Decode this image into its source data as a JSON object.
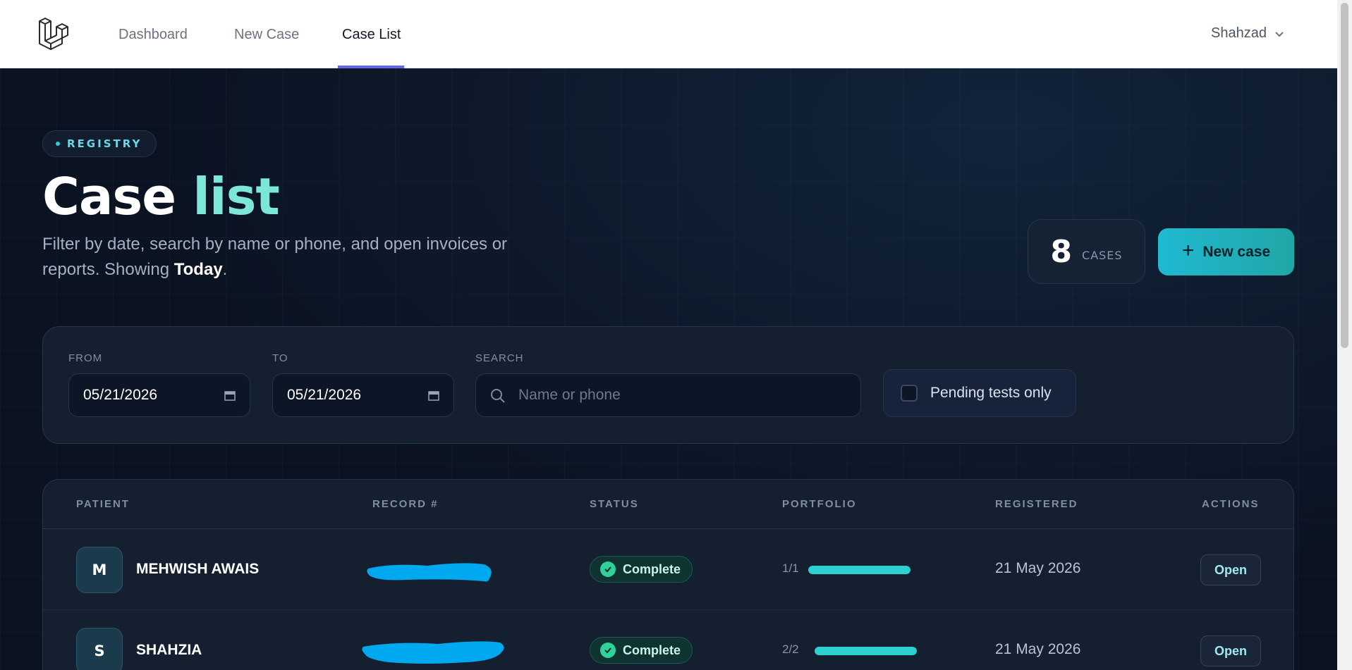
{
  "nav": {
    "links": [
      {
        "label": "Dashboard",
        "active": false
      },
      {
        "label": "New Case",
        "active": false
      },
      {
        "label": "Case List",
        "active": true
      }
    ],
    "user": "Shahzad"
  },
  "header": {
    "badge": "REGISTRY",
    "title_main": "Case",
    "title_accent": "list",
    "subtitle_prefix": "Filter by date, search by name or phone, and open invoices or reports. Showing ",
    "subtitle_strong": "Today",
    "subtitle_suffix": ".",
    "case_count": "8",
    "case_count_label": "CASES",
    "new_case_label": "New case"
  },
  "filters": {
    "from_label": "FROM",
    "from_value": "05/21/2026",
    "to_label": "TO",
    "to_value": "05/21/2026",
    "search_label": "SEARCH",
    "search_placeholder": "Name or phone",
    "pending_label": "Pending tests only",
    "pending_checked": false
  },
  "table": {
    "columns": [
      "PATIENT",
      "RECORD #",
      "STATUS",
      "PORTFOLIO",
      "REGISTERED",
      "ACTIONS"
    ],
    "rows": [
      {
        "initial": "M",
        "name": "MEHWISH AWAIS",
        "status": "Complete",
        "portfolio": "1/1",
        "progress": 1.0,
        "registered": "21 May 2026",
        "action": "Open"
      },
      {
        "initial": "S",
        "name": "SHAHZIA",
        "status": "Complete",
        "portfolio": "2/2",
        "progress": 1.0,
        "registered": "21 May 2026",
        "action": "Open"
      }
    ]
  },
  "colors": {
    "accent": "#7ce6d9",
    "primary_button": "#1fb9d2",
    "status_complete": "#2fd39a",
    "redaction": "#00a8f0"
  }
}
